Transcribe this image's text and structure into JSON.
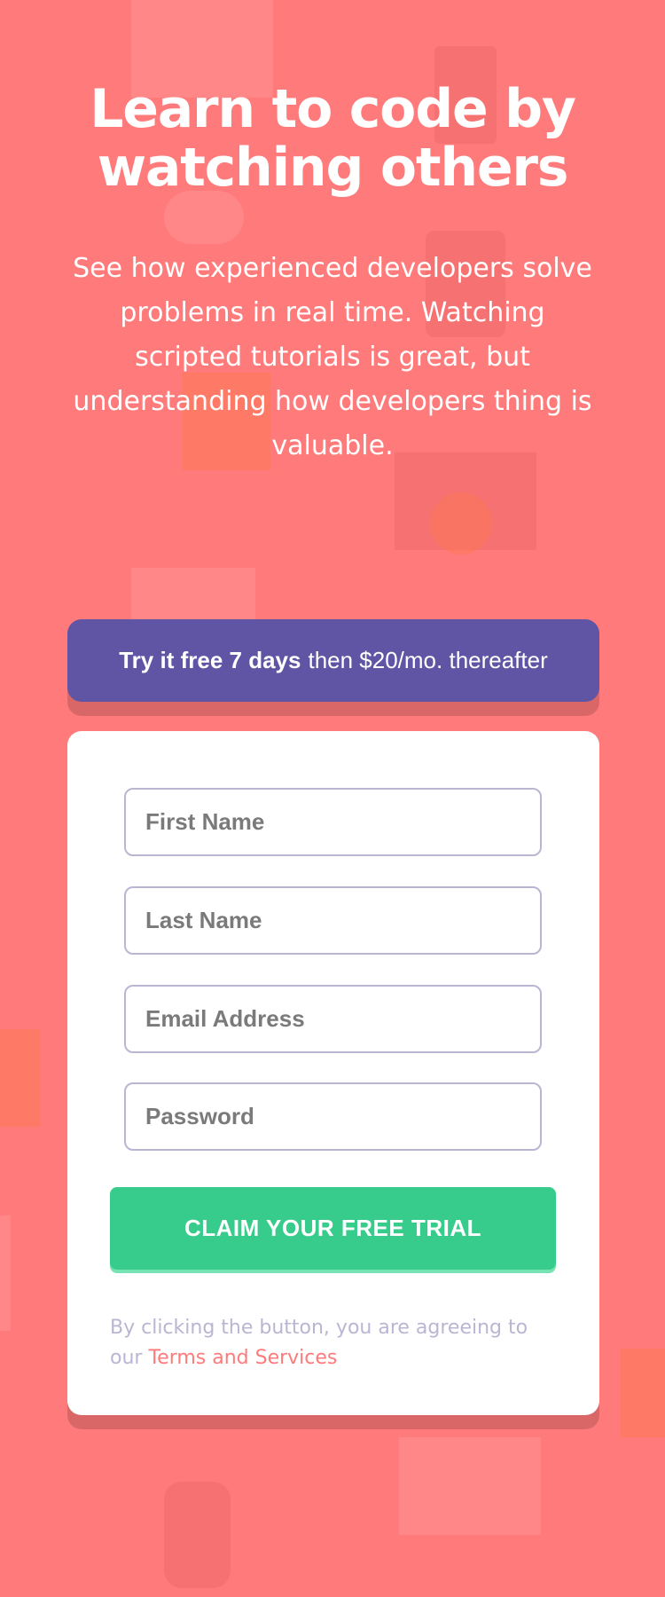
{
  "hero": {
    "title_line1": "Learn to code by",
    "title_line2": "watching others",
    "intro": "See how experienced developers solve problems in real time. Watching scripted tutorials is great, but understanding how developers thing is valuable."
  },
  "offer": {
    "bold": "Try it free 7 days",
    "rest": "then $20/mo. thereafter"
  },
  "form": {
    "first_name_placeholder": "First Name",
    "last_name_placeholder": "Last Name",
    "email_placeholder": "Email Address",
    "password_placeholder": "Password",
    "submit_label": "CLAIM YOUR FREE TRIAL",
    "terms_prefix": "By clicking the button, you are agreeing to our",
    "terms_link": "Terms and Services"
  },
  "colors": {
    "background": "#ff7a7a",
    "offer_bg": "#6055a5",
    "button": "#38cc8c",
    "field_border": "#b9b6d3",
    "terms_text": "#b9b6d3",
    "link": "#ff7a7a"
  }
}
